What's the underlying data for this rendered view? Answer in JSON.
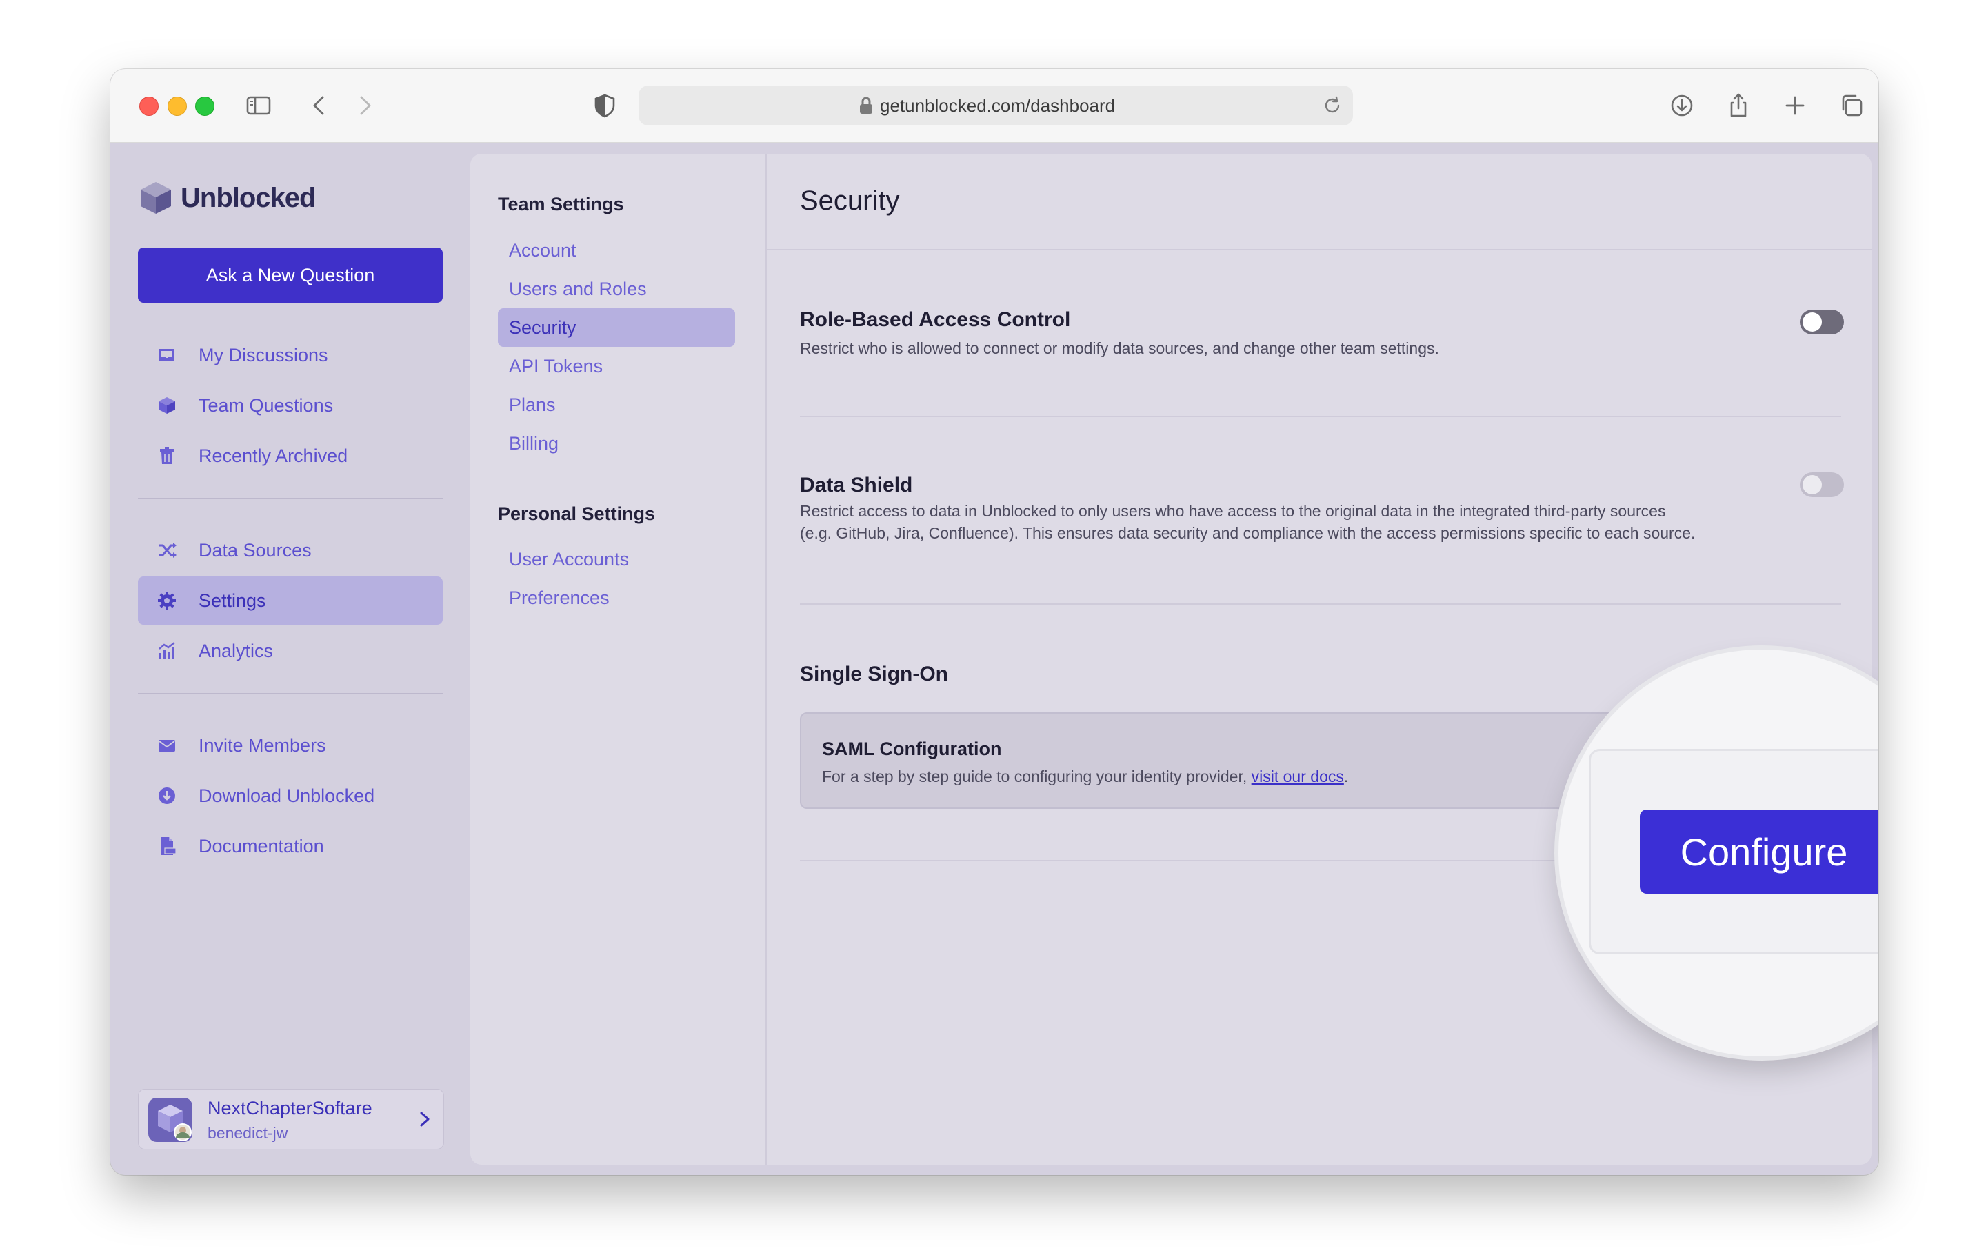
{
  "browser": {
    "url": "getunblocked.com/dashboard"
  },
  "brand": {
    "name": "Unblocked",
    "color": "#3f30c9"
  },
  "sidebar": {
    "ask_button": "Ask a New Question",
    "primary_items": [
      {
        "label": "My Discussions",
        "icon": "inbox-icon"
      },
      {
        "label": "Team Questions",
        "icon": "cube-icon"
      },
      {
        "label": "Recently Archived",
        "icon": "trash-icon"
      }
    ],
    "secondary_items": [
      {
        "label": "Data Sources",
        "icon": "shuffle-icon"
      },
      {
        "label": "Settings",
        "icon": "gear-icon",
        "active": true
      },
      {
        "label": "Analytics",
        "icon": "analytics-icon"
      }
    ],
    "tertiary_items": [
      {
        "label": "Invite Members",
        "icon": "envelope-icon"
      },
      {
        "label": "Download Unblocked",
        "icon": "download-icon"
      },
      {
        "label": "Documentation",
        "icon": "doc-icon"
      }
    ],
    "account": {
      "team": "NextChapterSoftare",
      "user": "benedict-jw"
    }
  },
  "settings_nav": {
    "team_title": "Team Settings",
    "team_items": [
      "Account",
      "Users and Roles",
      "Security",
      "API Tokens",
      "Plans",
      "Billing"
    ],
    "active_item": "Security",
    "personal_title": "Personal Settings",
    "personal_items": [
      "User Accounts",
      "Preferences"
    ]
  },
  "security": {
    "title": "Security",
    "rbac": {
      "title": "Role-Based Access Control",
      "description": "Restrict who is allowed to connect or modify data sources, and change other team settings.",
      "enabled": false
    },
    "data_shield": {
      "title": "Data Shield",
      "description_line1": "Restrict access to data in Unblocked to only users who have access to the original data in the integrated third-party sources",
      "description_line2": "(e.g. GitHub, Jira, Confluence). This ensures data security and compliance with the access permissions specific to each source.",
      "enabled": false
    },
    "sso": {
      "title": "Single Sign-On",
      "saml_title": "SAML Configuration",
      "saml_desc": "For a step by step guide to configuring your identity provider, ",
      "saml_link": "visit our docs",
      "saml_desc_end": ".",
      "configure_button": "Configure"
    }
  }
}
